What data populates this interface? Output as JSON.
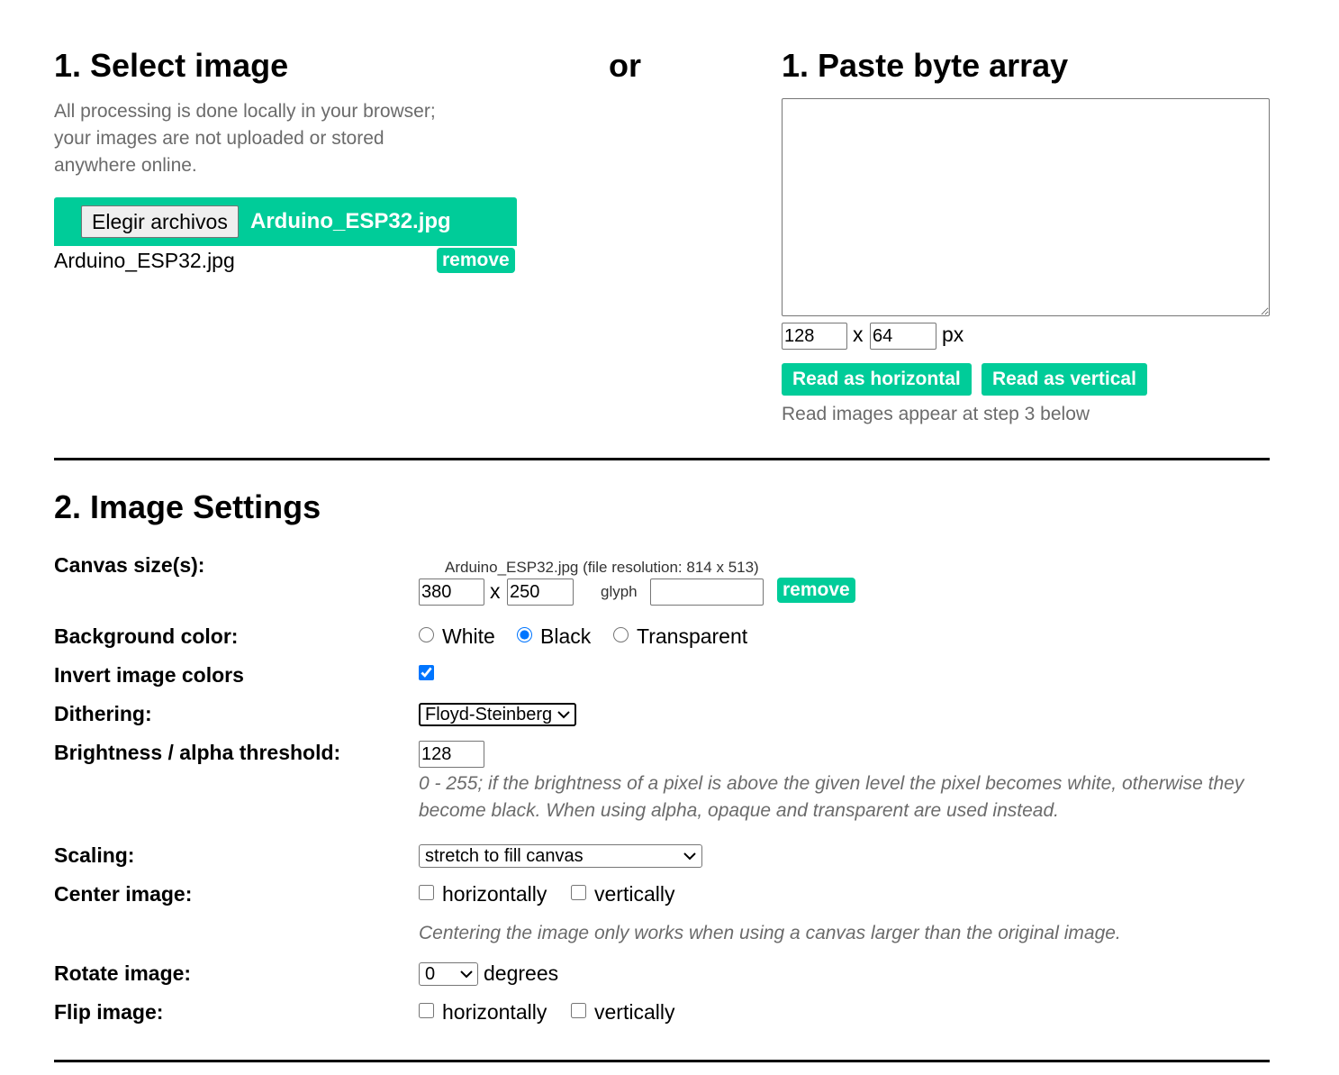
{
  "select_image": {
    "heading": "1. Select image",
    "description_lines": [
      "All processing is done locally in your browser;",
      "your images are not uploaded or stored",
      "anywhere online."
    ],
    "choose_button": "Elegir archivos",
    "chosen_file": "Arduino_ESP32.jpg",
    "file_list": [
      {
        "name": "Arduino_ESP32.jpg",
        "remove_label": "remove"
      }
    ]
  },
  "or_label": "or",
  "paste_bytes": {
    "heading": "1. Paste byte array",
    "textarea_value": "",
    "width_value": "128",
    "x_sep": "x",
    "height_value": "64",
    "unit": "px",
    "read_horizontal_label": "Read as horizontal",
    "read_vertical_label": "Read as vertical",
    "note": "Read images appear at step 3 below"
  },
  "image_settings": {
    "heading": "2. Image Settings",
    "canvas_size": {
      "label": "Canvas size(s):",
      "file_caption": "Arduino_ESP32.jpg (file resolution: 814 x 513)",
      "width_value": "380",
      "x_sep": "x",
      "height_value": "250",
      "glyph_label": "glyph",
      "glyph_value": "",
      "remove_label": "remove"
    },
    "background": {
      "label": "Background color:",
      "options": [
        "White",
        "Black",
        "Transparent"
      ],
      "selected": "Black"
    },
    "invert": {
      "label": "Invert image colors",
      "checked": true
    },
    "dithering": {
      "label": "Dithering:",
      "selected": "Floyd-Steinberg"
    },
    "threshold": {
      "label": "Brightness / alpha threshold:",
      "value": "128",
      "note_line1": "0 - 255; if the brightness of a pixel is above the given level the pixel becomes white, otherwise they",
      "note_line2": "become black. When using alpha, opaque and transparent are used instead."
    },
    "scaling": {
      "label": "Scaling:",
      "selected": "stretch to fill canvas"
    },
    "center": {
      "label": "Center image:",
      "horizontal_label": "horizontally",
      "vertical_label": "vertically",
      "horizontal_checked": false,
      "vertical_checked": false,
      "note": "Centering the image only works when using a canvas larger than the original image."
    },
    "rotate": {
      "label": "Rotate image:",
      "selected": "0",
      "unit": "degrees"
    },
    "flip": {
      "label": "Flip image:",
      "horizontal_label": "horizontally",
      "vertical_label": "vertically",
      "horizontal_checked": false,
      "vertical_checked": false
    }
  },
  "colors": {
    "accent": "#00cc99",
    "muted_text": "#6b6b6b"
  },
  "icons": {
    "select_chevron": "chevron-down-icon"
  }
}
